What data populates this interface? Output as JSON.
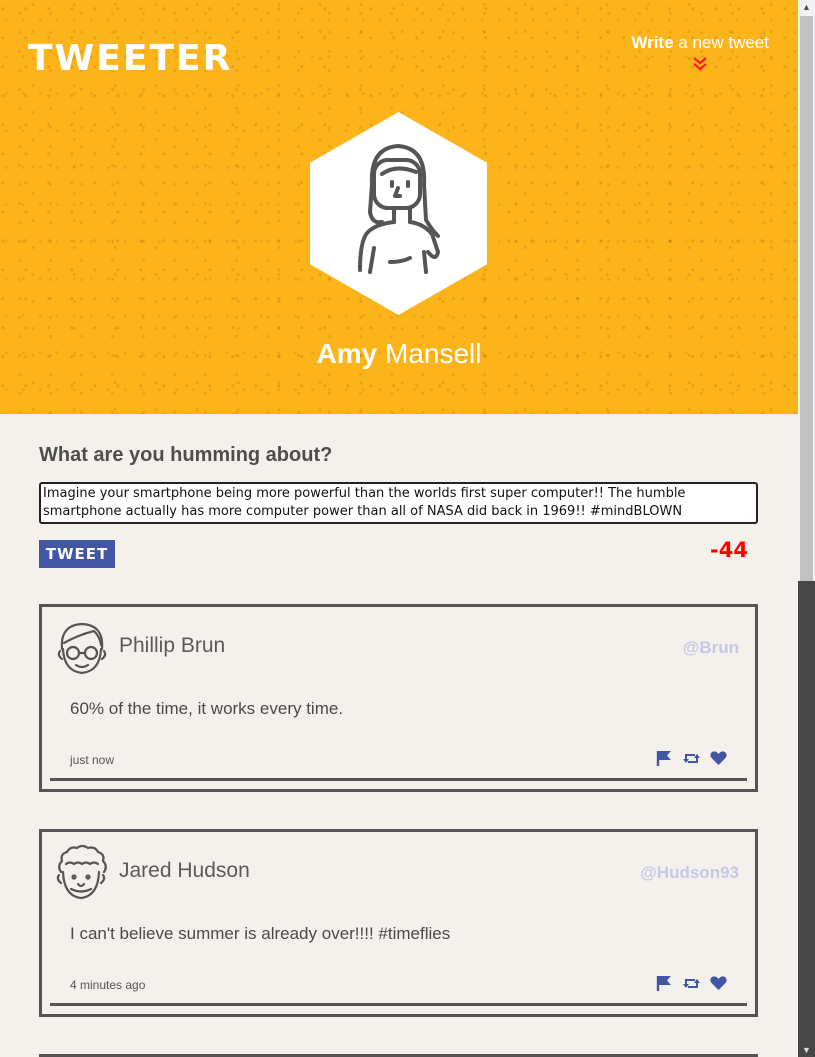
{
  "app": {
    "logo": "TWEETER",
    "compose_link_bold": "Write",
    "compose_link_rest": " a new tweet"
  },
  "profile": {
    "first_name": "Amy",
    "last_name": " Mansell"
  },
  "composer": {
    "heading": "What are you humming about?",
    "text": "Imagine your smartphone being more powerful than the worlds first super computer!! The humble smartphone actually has more computer power than all of NASA did back in 1969!! #mindBLOWN",
    "button_label": "TWEET",
    "counter": "-44"
  },
  "colors": {
    "hero": "#fdb41b",
    "accent": "#4256a4",
    "counter": "#ff0000",
    "handle": "#c4c8e6"
  },
  "tweets": [
    {
      "name": "Phillip Brun",
      "handle": "@Brun",
      "text": "60% of the time, it works every time.",
      "time": "just now",
      "avatar_icon": "glasses-man-icon"
    },
    {
      "name": "Jared Hudson",
      "handle": "@Hudson93",
      "text": "I can't believe summer is already over!!!! #timeflies",
      "time": "4 minutes ago",
      "avatar_icon": "curly-hair-man-icon"
    }
  ]
}
